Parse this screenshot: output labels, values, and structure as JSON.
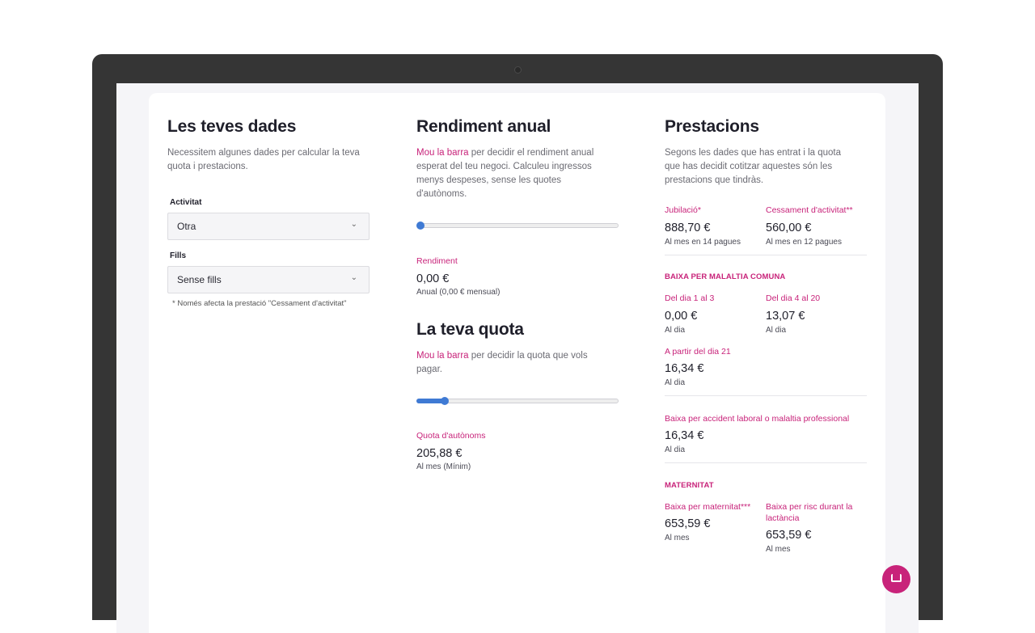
{
  "col1": {
    "title": "Les teves dades",
    "desc": "Necessitem algunes dades per calcular la teva quota i prestacions.",
    "activitat_label": "Activitat",
    "activitat_value": "Otra",
    "fills_label": "Fills",
    "fills_value": "Sense fills",
    "note": "* Només afecta la prestació \"Cessament d'activitat\""
  },
  "col2": {
    "rendiment_title": "Rendiment anual",
    "rendiment_link": "Mou la barra",
    "rendiment_desc": " per decidir el rendiment anual esperat del teu negoci. Calculeu ingressos menys despeses, sense les quotes d'autònoms.",
    "rendiment_slider_percent": 0,
    "rendiment_label": "Rendiment",
    "rendiment_value": "0,00 €",
    "rendiment_sub": "Anual (0,00 € mensual)",
    "quota_title": "La teva quota",
    "quota_link": "Mou la barra",
    "quota_desc": " per decidir la quota que vols pagar.",
    "quota_slider_percent": 14,
    "quota_label": "Quota d'autònoms",
    "quota_value": "205,88 €",
    "quota_sub": "Al mes (Mínim)"
  },
  "col3": {
    "title": "Prestacions",
    "desc": "Segons les dades que has entrat i la quota que has decidit cotitzar aquestes són les prestacions que tindràs.",
    "jubilacio_label": "Jubilació*",
    "jubilacio_value": "888,70 €",
    "jubilacio_sub": "Al mes en 14 pagues",
    "cessament_label": "Cessament d'activitat**",
    "cessament_value": "560,00 €",
    "cessament_sub": "Al mes en 12 pagues",
    "baixa_title": "BAIXA PER MALALTIA COMUNA",
    "dia1_label": "Del dia 1 al 3",
    "dia1_value": "0,00 €",
    "dia1_sub": "Al dia",
    "dia4_label": "Del dia 4 al 20",
    "dia4_value": "13,07 €",
    "dia4_sub": "Al dia",
    "dia21_label": "A partir del dia 21",
    "dia21_value": "16,34 €",
    "dia21_sub": "Al dia",
    "accident_label": "Baixa per accident laboral o malaltia professional",
    "accident_value": "16,34 €",
    "accident_sub": "Al dia",
    "maternitat_title": "MATERNITAT",
    "mat_label": "Baixa per maternitat***",
    "mat_value": "653,59 €",
    "mat_sub": "Al mes",
    "risc_label": "Baixa per risc durant la lactància",
    "risc_value": "653,59 €",
    "risc_sub": "Al mes"
  },
  "icons": {
    "chevron": "chevron-down-icon",
    "chat": "chat-icon"
  }
}
